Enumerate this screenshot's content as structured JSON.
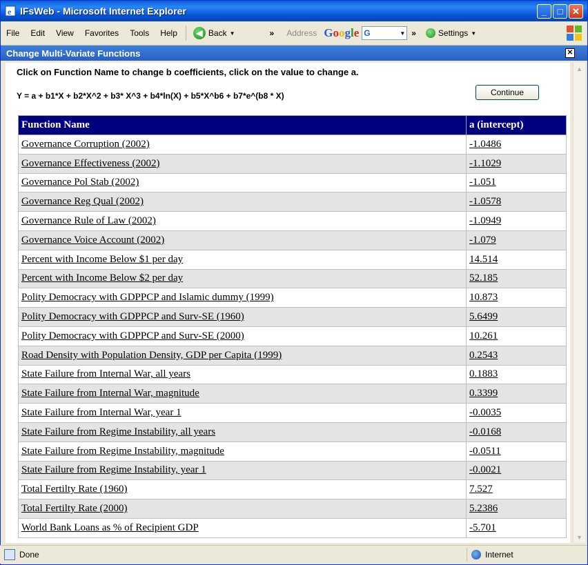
{
  "window": {
    "title": "IFsWeb - Microsoft Internet Explorer"
  },
  "menu": [
    "File",
    "Edit",
    "View",
    "Favorites",
    "Tools",
    "Help"
  ],
  "toolbar": {
    "back_label": "Back",
    "address_label": "Address",
    "google_label": "Google",
    "search_engine": "G",
    "settings_label": "Settings"
  },
  "panel": {
    "title": "Change Multi-Variate Functions"
  },
  "instructions": "Click on Function Name to change b coefficients, click on the value to change a.",
  "formula": "Y = a + b1*X + b2*X^2 + b3* X^3 + b4*ln(X) + b5*X^b6 + b7*e^(b8 * X)",
  "continue_label": "Continue",
  "table": {
    "headers": [
      "Function Name",
      "a (intercept)"
    ],
    "rows": [
      {
        "name": "Governance Corruption (2002)",
        "value": "-1.0486"
      },
      {
        "name": "Governance Effectiveness (2002)",
        "value": "-1.1029"
      },
      {
        "name": "Governance Pol Stab (2002)",
        "value": "-1.051"
      },
      {
        "name": "Governance Reg Qual (2002)",
        "value": "-1.0578"
      },
      {
        "name": "Governance Rule of Law (2002)",
        "value": "-1.0949"
      },
      {
        "name": "Governance Voice Account (2002)",
        "value": "-1.079"
      },
      {
        "name": "Percent with Income Below $1 per day",
        "value": "14.514"
      },
      {
        "name": "Percent with Income Below $2 per day",
        "value": "52.185"
      },
      {
        "name": "Polity Democracy with GDPPCP and Islamic dummy (1999)",
        "value": "10.873"
      },
      {
        "name": "Polity Democracy with GDPPCP and Surv-SE (1960)",
        "value": "5.6499"
      },
      {
        "name": "Polity Democracy with GDPPCP and Surv-SE (2000)",
        "value": "10.261"
      },
      {
        "name": "Road Density with Population Density, GDP per Capita (1999)",
        "value": "0.2543"
      },
      {
        "name": "State Failure from Internal War, all years",
        "value": "0.1883"
      },
      {
        "name": "State Failure from Internal War, magnitude",
        "value": "0.3399"
      },
      {
        "name": "State Failure from Internal War, year 1",
        "value": "-0.0035"
      },
      {
        "name": "State Failure from Regime Instability, all years",
        "value": "-0.0168"
      },
      {
        "name": "State Failure from Regime Instability, magnitude",
        "value": "-0.0511"
      },
      {
        "name": "State Failure from Regime Instability, year 1",
        "value": "-0.0021"
      },
      {
        "name": "Total Fertilty Rate (1960)",
        "value": "7.527"
      },
      {
        "name": "Total Fertilty Rate (2000)",
        "value": "5.2386"
      },
      {
        "name": "World Bank Loans as % of Recipient GDP",
        "value": "-5.701"
      }
    ]
  },
  "status": {
    "left": "Done",
    "zone": "Internet"
  }
}
